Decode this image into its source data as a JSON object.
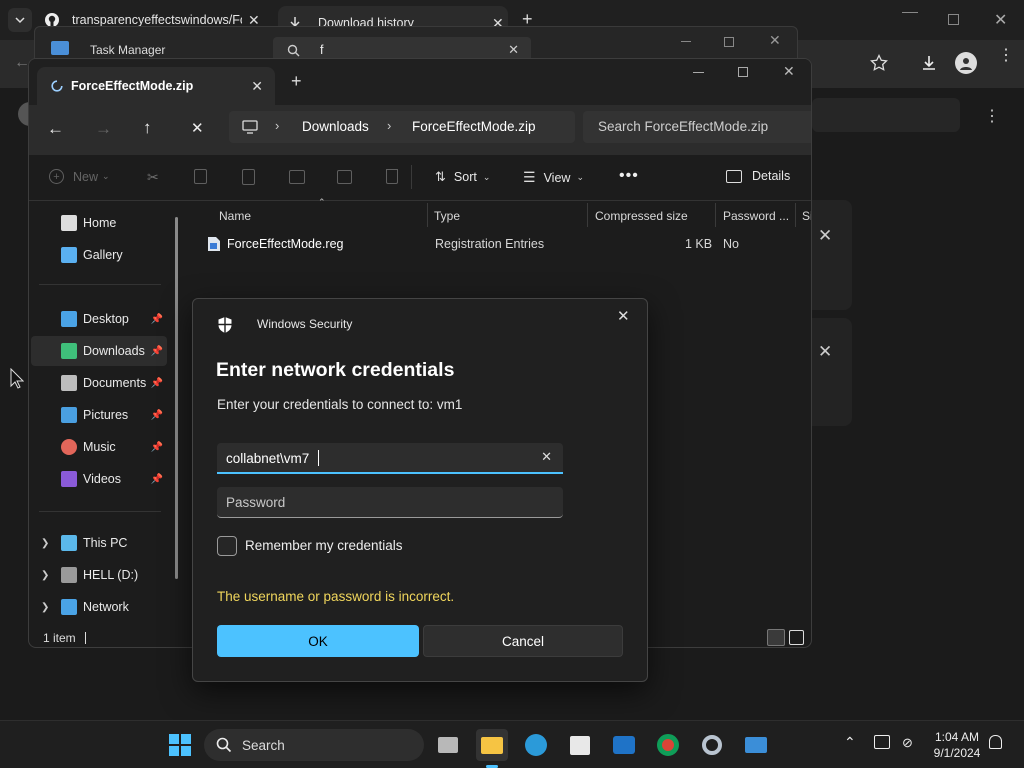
{
  "chrome": {
    "tab1_title": "transparencyeffectswindows/Fo",
    "tab2_title": "Download history"
  },
  "taskmgr": {
    "title": "Task Manager",
    "search_value": "f"
  },
  "explorer": {
    "tab_title": "ForceEffectMode.zip",
    "breadcrumb": [
      "Downloads",
      "ForceEffectMode.zip"
    ],
    "search_placeholder": "Search ForceEffectMode.zip",
    "cmd": {
      "new": "New",
      "sort": "Sort",
      "view": "View",
      "details": "Details"
    },
    "columns": [
      "Name",
      "Type",
      "Compressed size",
      "Password ...",
      "Si"
    ],
    "files": [
      {
        "name": "ForceEffectMode.reg",
        "type": "Registration Entries",
        "size": "1 KB",
        "password": "No"
      }
    ],
    "sidebar": {
      "top": [
        "Home",
        "Gallery"
      ],
      "pinned": [
        "Desktop",
        "Downloads",
        "Documents",
        "Pictures",
        "Music",
        "Videos"
      ],
      "drives": [
        "This PC",
        "HELL (D:)",
        "Network"
      ]
    },
    "status": "1 item"
  },
  "dialog": {
    "app_name": "Windows Security",
    "title": "Enter network credentials",
    "subtitle": "Enter your credentials to connect to: vm1",
    "username_value": "collabnet\\vm7",
    "password_placeholder": "Password",
    "remember_label": "Remember my credentials",
    "error": "The username or password is incorrect.",
    "ok": "OK",
    "cancel": "Cancel",
    "accent": "#4cc2ff",
    "error_color": "#f0d65c"
  },
  "taskbar": {
    "search_label": "Search",
    "time": "1:04 AM",
    "date": "9/1/2024"
  }
}
